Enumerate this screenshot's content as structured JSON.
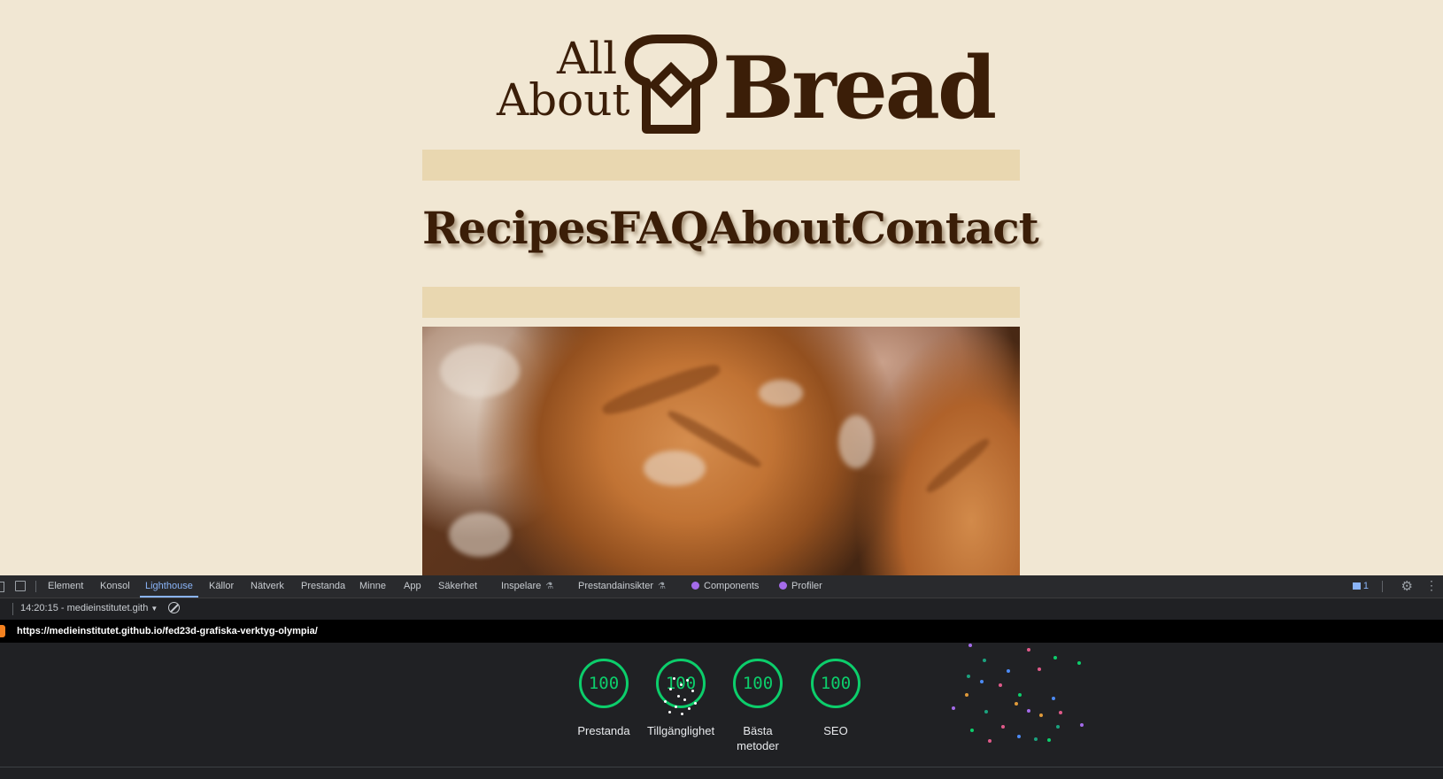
{
  "site": {
    "logo": {
      "small_top": "All",
      "small_bottom": "About",
      "large": "Bread"
    },
    "nav": [
      "Recipes",
      "FAQ",
      "About",
      "Contact"
    ],
    "hero_image_icon": "bread-photo"
  },
  "devtools": {
    "tabs": [
      "Element",
      "Konsol",
      "Lighthouse",
      "Källor",
      "Nätverk",
      "Prestanda",
      "Minne",
      "App",
      "Säkerhet",
      "Inspelare",
      "Prestandainsikter",
      "Components",
      "Profiler"
    ],
    "active_tab": "Lighthouse",
    "issues_count": "1",
    "report_select": "14:20:15 - medieinstitutet.gith",
    "url": "https://medieinstitutet.github.io/fed23d-grafiska-verktyg-olympia/",
    "scores": [
      {
        "label": "Prestanda",
        "value": "100"
      },
      {
        "label": "Tillgänglighet",
        "value": "100"
      },
      {
        "label": "Bästa metoder",
        "value": "100"
      },
      {
        "label": "SEO",
        "value": "100"
      }
    ],
    "colors": {
      "pass": "#0cce6b",
      "accent": "#8ab4f8",
      "panel": "#202124"
    }
  }
}
